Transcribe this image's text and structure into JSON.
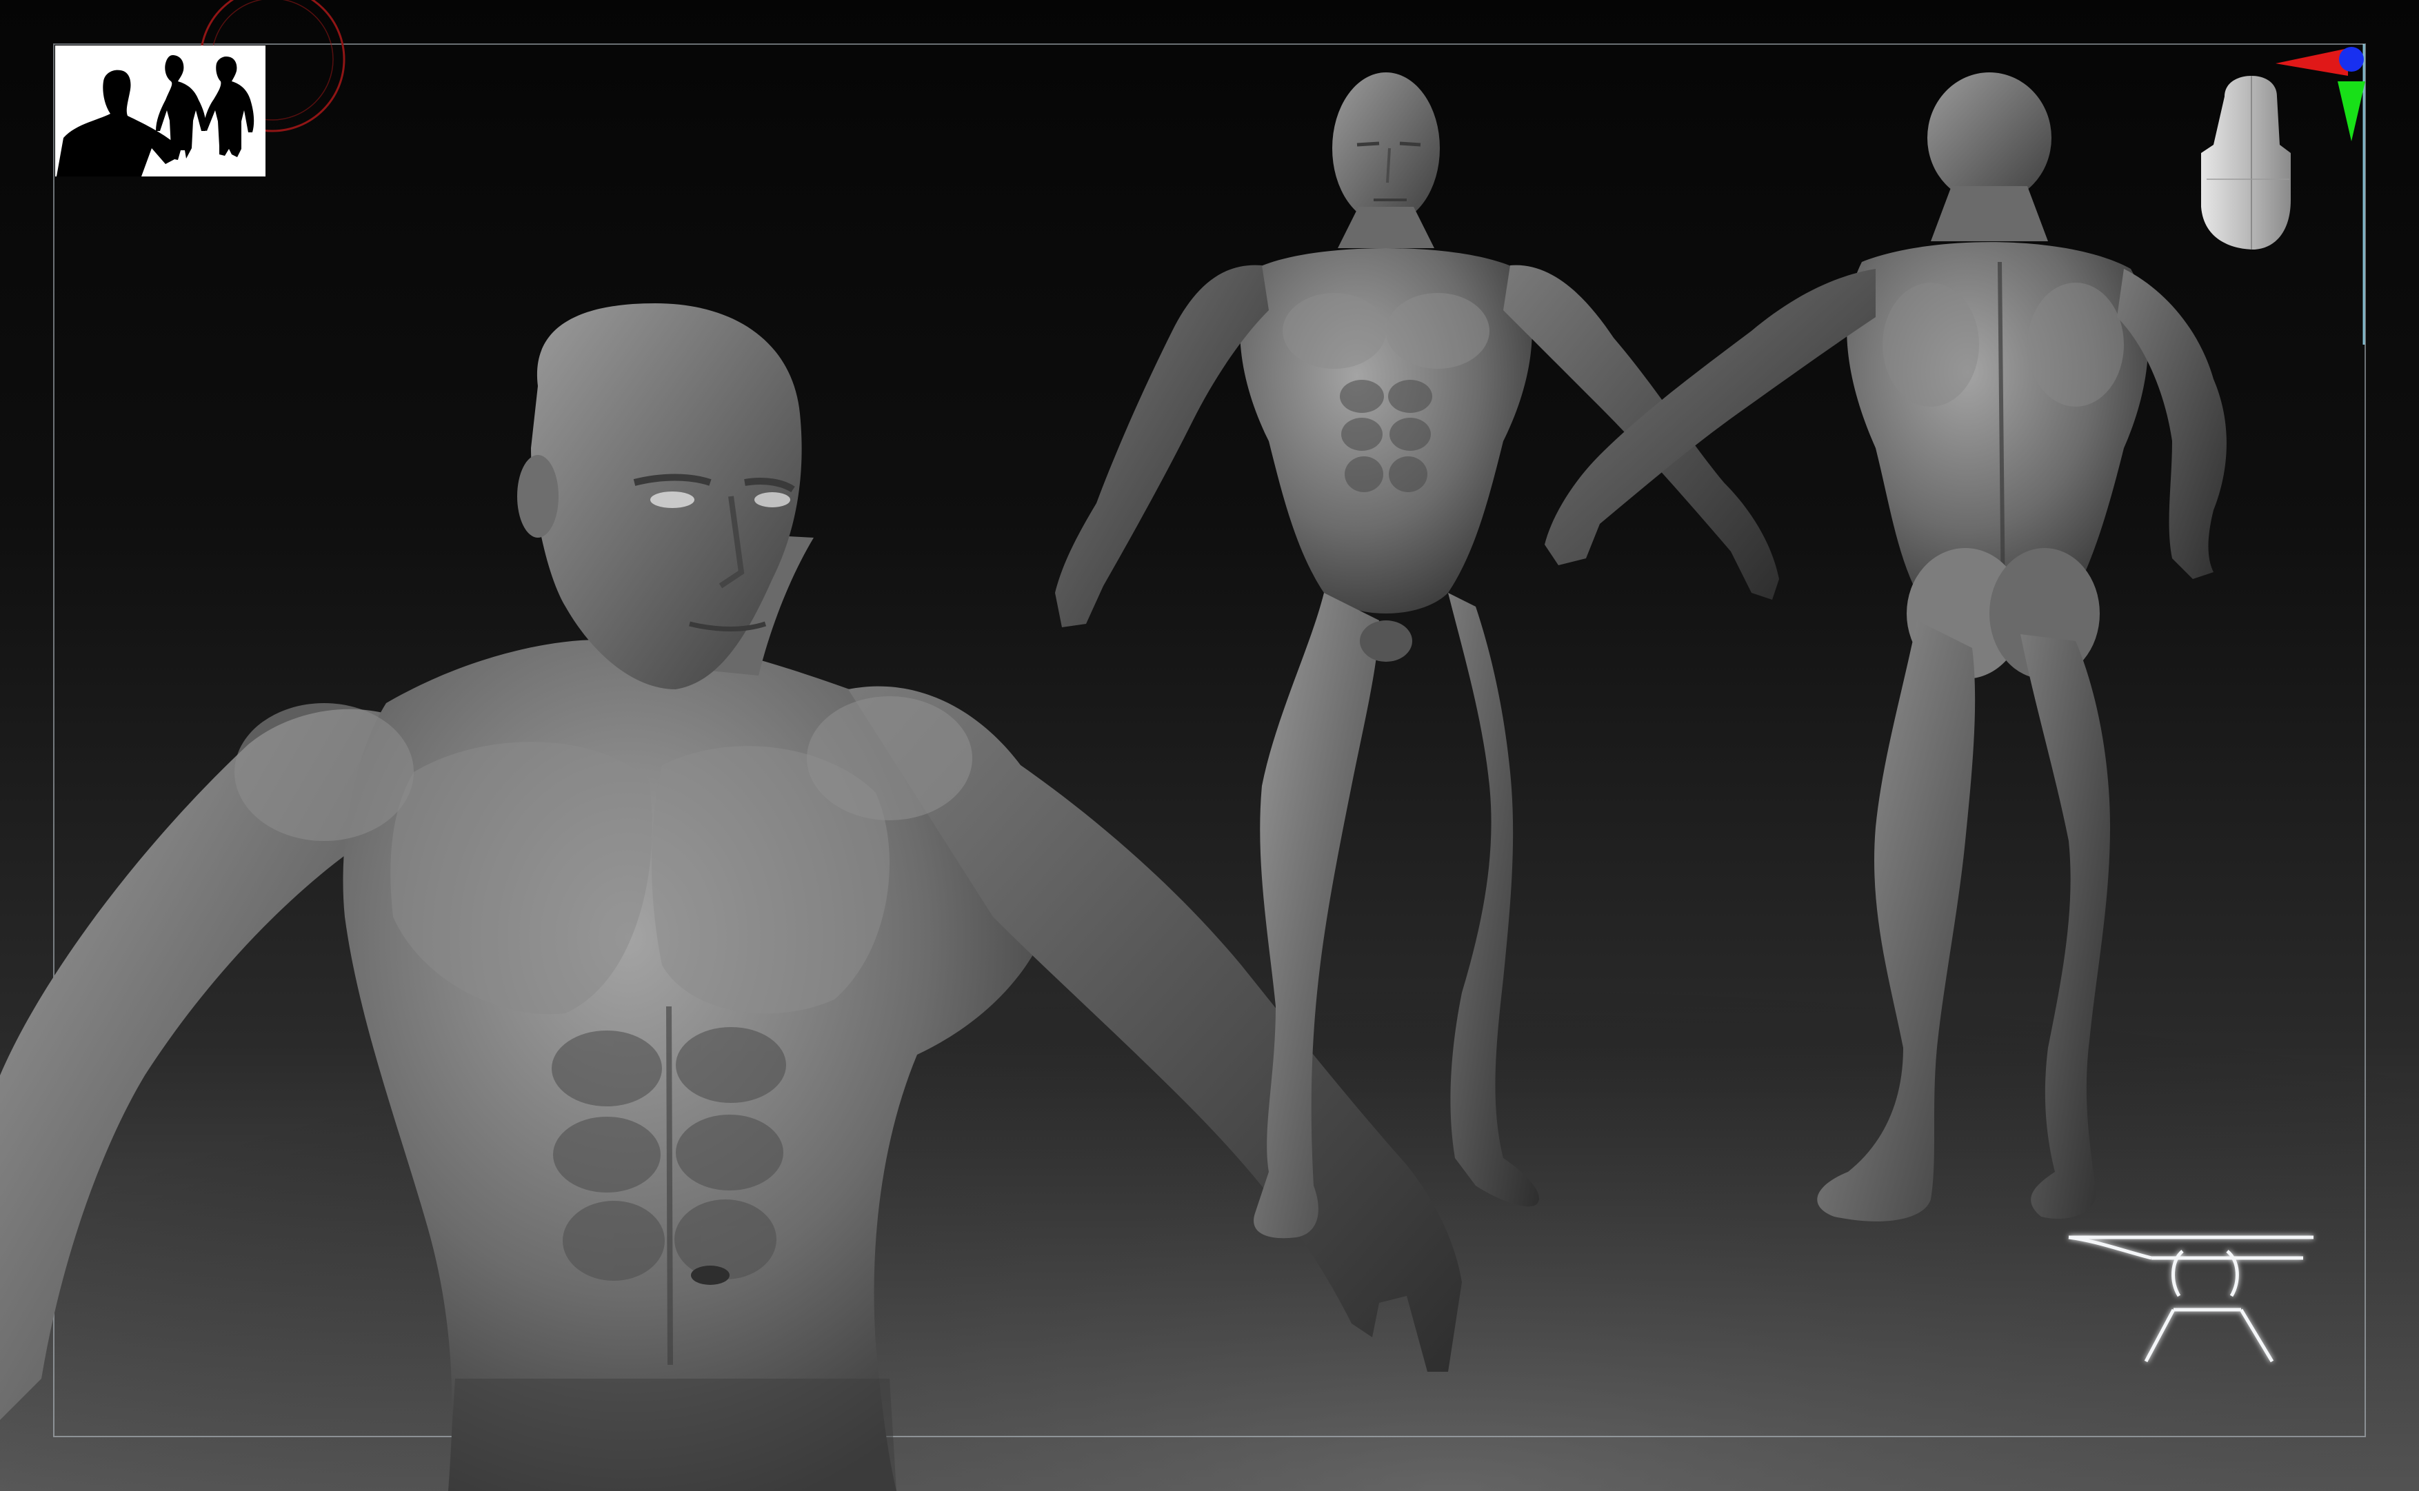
{
  "app": {
    "background_color": "#0a0a0a",
    "floor_color": "#5a5a5a",
    "frame_color": "#c8d2dc",
    "accent_red": "#d81818",
    "accent_green": "#18d818",
    "accent_blue": "#1818e8"
  },
  "canvas": {
    "subject": "3d-sculpt-viewport",
    "figures": [
      {
        "name": "closeup-torso-figure"
      },
      {
        "name": "front-standing-figure"
      },
      {
        "name": "back-standing-figure"
      }
    ]
  },
  "thumbnail": {
    "icon": "silhouette-thumbnail-icon",
    "background_color": "#ffffff",
    "silhouette_color": "#000000"
  },
  "gizmo": {
    "icon": "axis-gizmo-icon",
    "x_color": "#e01818",
    "y_color": "#18e018",
    "z_color": "#1830f0"
  },
  "navigation_head": {
    "icon": "navigation-head-icon"
  },
  "floor_grid": {
    "icon": "floor-grid-icon"
  },
  "focal_circle": {
    "icon": "focal-target-icon",
    "color": "#9a1414"
  }
}
